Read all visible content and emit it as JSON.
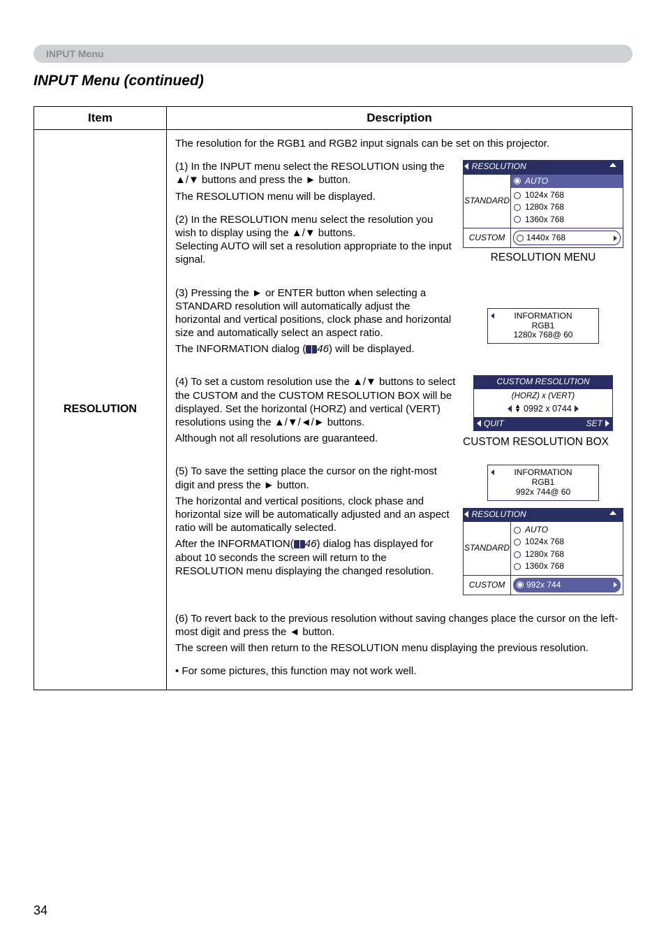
{
  "section_label": "INPUT Menu",
  "subtitle": "INPUT Menu (continued)",
  "page_number": "34",
  "table": {
    "header_item": "Item",
    "header_desc": "Description",
    "row_label": "RESOLUTION"
  },
  "desc": {
    "intro": "The resolution for the RGB1 and RGB2 input signals can be set on this projector.",
    "step1a": "(1) In the INPUT menu select the RESOLUTION using the ▲/▼ buttons and press the ► button.",
    "step1b": "The RESOLUTION menu will be displayed.",
    "step2": "(2)  In the RESOLUTION menu select the resolution you wish to display using the ▲/▼ buttons.\nSelecting AUTO will set a resolution appropriate to the input signal.",
    "step3a": "(3) Pressing the ► or ENTER button when selecting a STANDARD resolution will automatically adjust the horizontal and vertical positions, clock phase and horizontal size and automatically select an aspect ratio.",
    "step3b_pre": "The INFORMATION dialog (",
    "step3b_ref": "46",
    "step3b_post": ")  will be displayed.",
    "step4a": "(4) To set a custom resolution use the ▲/▼ buttons to select the CUSTOM and the CUSTOM RESOLUTION BOX will be displayed. Set the horizontal (HORZ) and vertical (VERT) resolutions using the ▲/▼/◄/► buttons.",
    "step4b": "Although not all resolutions are guaranteed.",
    "step5a": "(5) To save the setting place the cursor on the right-most digit and press the ► button.",
    "step5b": "The horizontal and vertical positions, clock phase and horizontal size will be automatically adjusted and an aspect ratio will be automatically selected.",
    "step5c_pre": "After the INFORMATION(",
    "step5c_ref": "46",
    "step5c_post": ") dialog has displayed for about 10 seconds the screen will return to the RESOLUTION menu displaying the changed resolution.",
    "step6a": "(6) To revert back to the previous resolution without saving changes place the cursor on the left-most digit and press the ◄ button.",
    "step6b": "The screen will then return to the RESOLUTION menu displaying the previous resolution.",
    "note": "• For some pictures, this function may not work well."
  },
  "osd1": {
    "title": "RESOLUTION",
    "auto": "AUTO",
    "standard": "STANDARD",
    "opts": [
      "1024x  768",
      "1280x  768",
      "1360x  768"
    ],
    "custom": "CUSTOM",
    "custom_val": "1440x  768",
    "caption": "RESOLUTION MENU"
  },
  "info1": {
    "title": "INFORMATION",
    "l1": "RGB1",
    "l2": "1280x 768@ 60"
  },
  "custom_box": {
    "title": "CUSTOM RESOLUTION",
    "horz_vert": "(HORZ)  x  (VERT)",
    "val": "0992  x  0744",
    "quit": "QUIT",
    "set": "SET",
    "caption": "CUSTOM RESOLUTION BOX"
  },
  "info2": {
    "title": "INFORMATION",
    "l1": "RGB1",
    "l2": "992x 744@ 60"
  },
  "osd2": {
    "title": "RESOLUTION",
    "auto": "AUTO",
    "standard": "STANDARD",
    "opts": [
      "1024x  768",
      "1280x  768",
      "1360x  768"
    ],
    "custom": "CUSTOM",
    "custom_val": "992x  744"
  }
}
